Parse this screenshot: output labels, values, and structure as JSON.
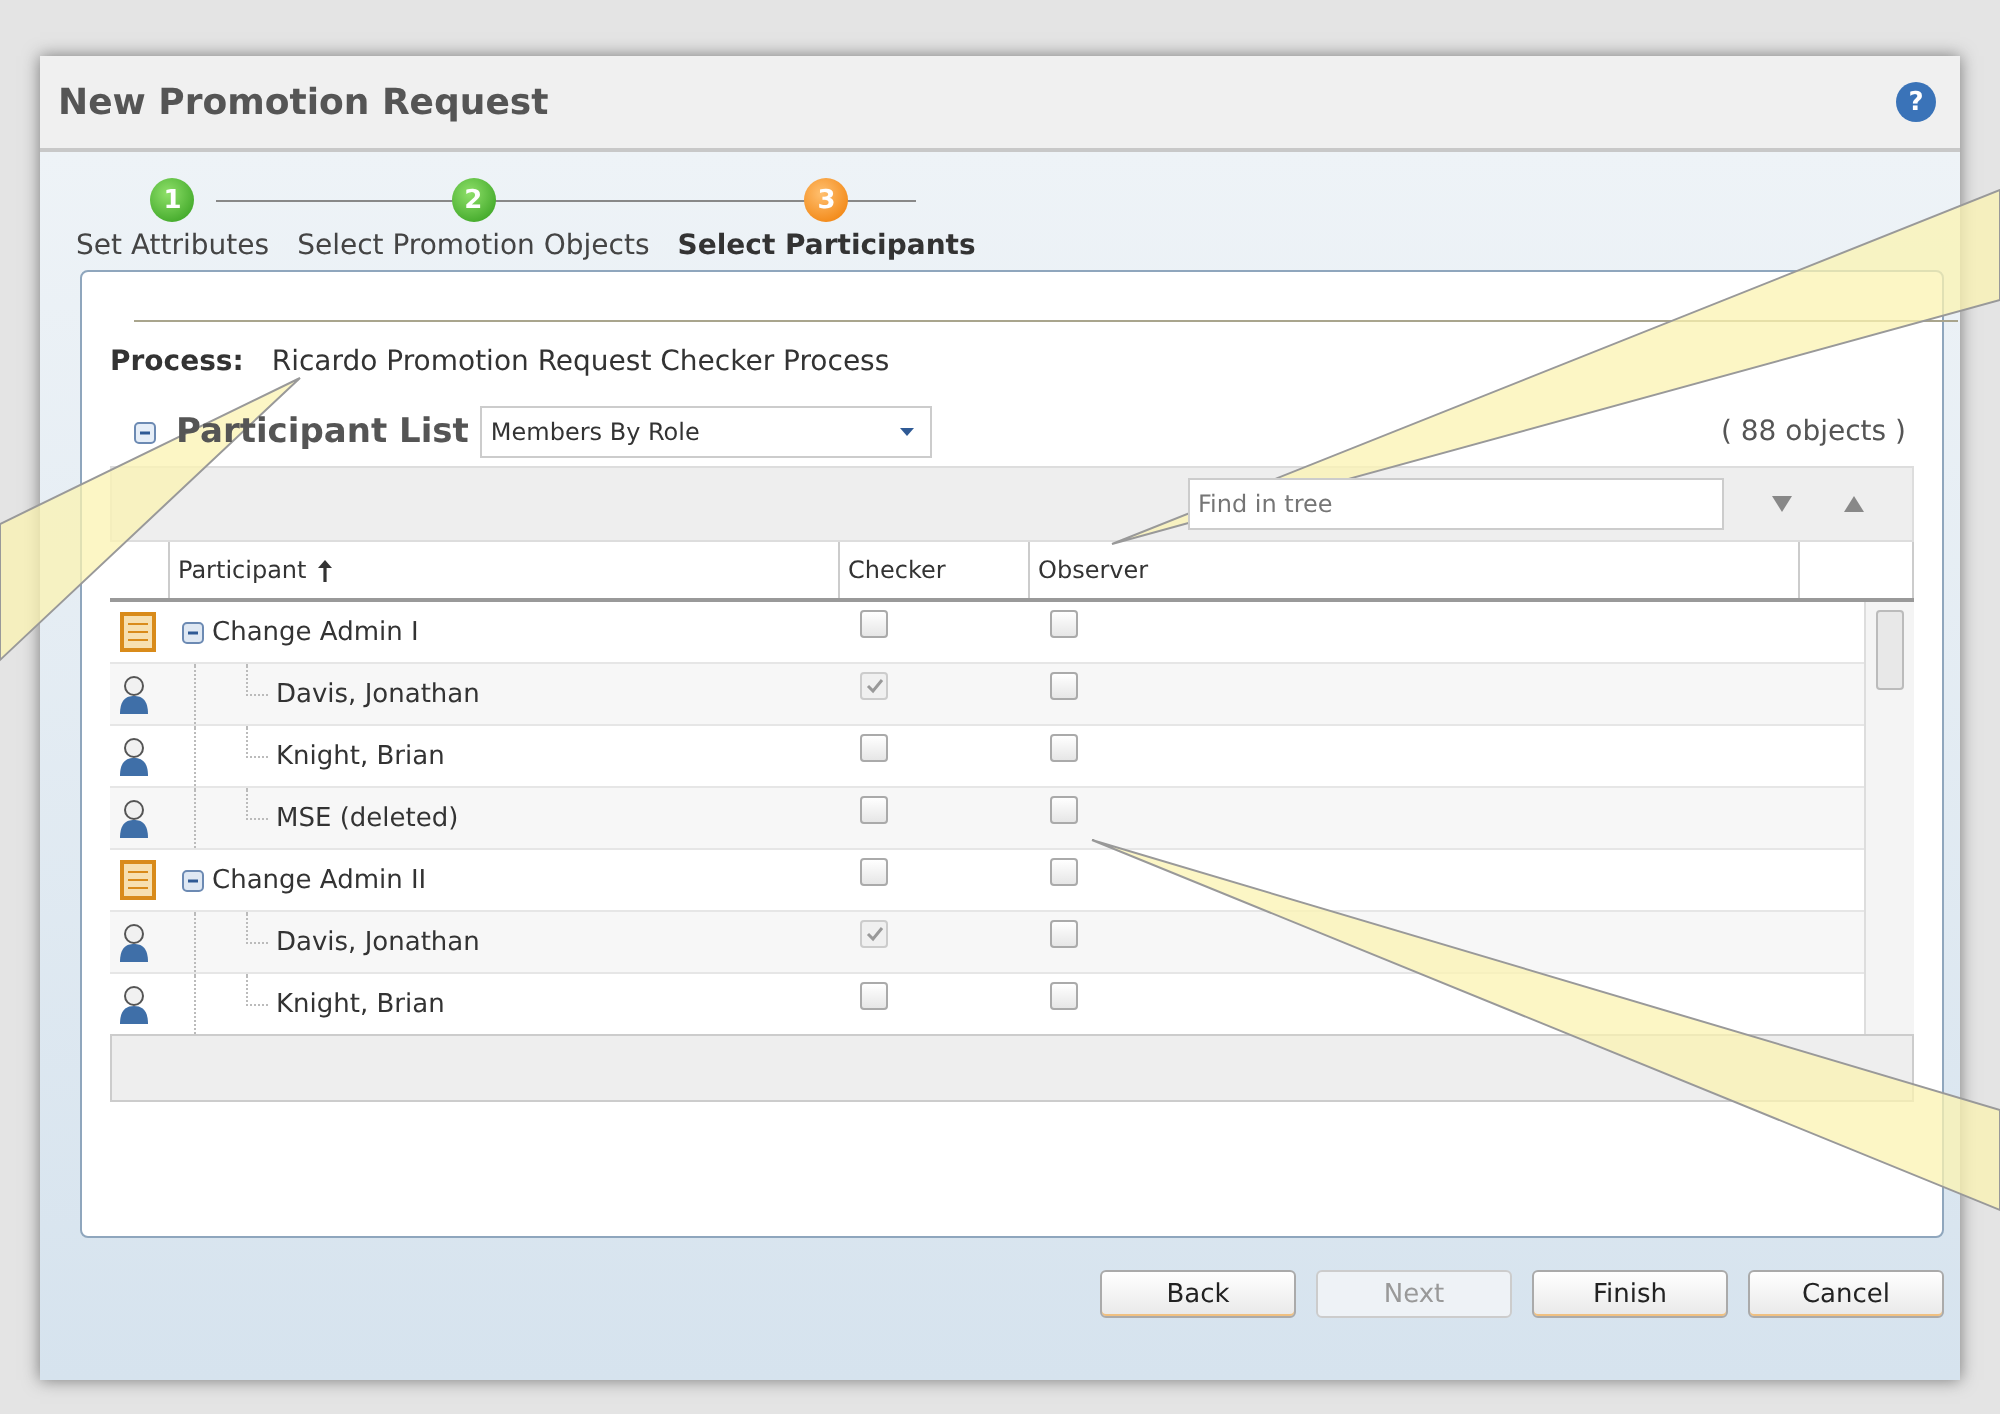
{
  "window": {
    "title": "New Promotion Request",
    "help": "?"
  },
  "steps": [
    {
      "number": "1",
      "label": "Set Attributes",
      "selected": false
    },
    {
      "number": "2",
      "label": "Select Promotion Objects",
      "selected": false
    },
    {
      "number": "3",
      "label": "Select Participants",
      "selected": true
    }
  ],
  "process": {
    "label": "Process:",
    "value": "Ricardo Promotion Request Checker Process"
  },
  "participant_list": {
    "title": "Participant List",
    "expanded": true,
    "view": "Members By Role",
    "count": "( 88 objects )"
  },
  "search": {
    "placeholder": "Find in tree"
  },
  "table": {
    "columns": [
      {
        "label": "Participant",
        "sorted": true
      },
      {
        "label": "Checker",
        "sorted": false
      },
      {
        "label": "Observer",
        "sorted": false
      }
    ],
    "rows": [
      {
        "kind": "role",
        "name": "Change Admin I",
        "expanded": true,
        "checker": false,
        "observer": false,
        "children": [
          {
            "kind": "person",
            "name": "Davis, Jonathan",
            "checker": true,
            "observer": false
          },
          {
            "kind": "person",
            "name": "Knight, Brian",
            "checker": false,
            "observer": false
          },
          {
            "kind": "person",
            "name": "MSE (deleted)",
            "checker": false,
            "observer": false
          }
        ]
      },
      {
        "kind": "role",
        "name": "Change Admin II",
        "expanded": true,
        "checker": false,
        "observer": false,
        "children": [
          {
            "kind": "person",
            "name": "Davis, Jonathan",
            "checker": true,
            "observer": false
          },
          {
            "kind": "person",
            "name": "Knight, Brian",
            "checker": false,
            "observer": false
          }
        ]
      }
    ]
  },
  "buttons": [
    {
      "label": "Back",
      "disabled": false
    },
    {
      "label": "Next",
      "disabled": true
    },
    {
      "label": "Finish",
      "disabled": false
    },
    {
      "label": "Cancel",
      "disabled": false
    }
  ]
}
